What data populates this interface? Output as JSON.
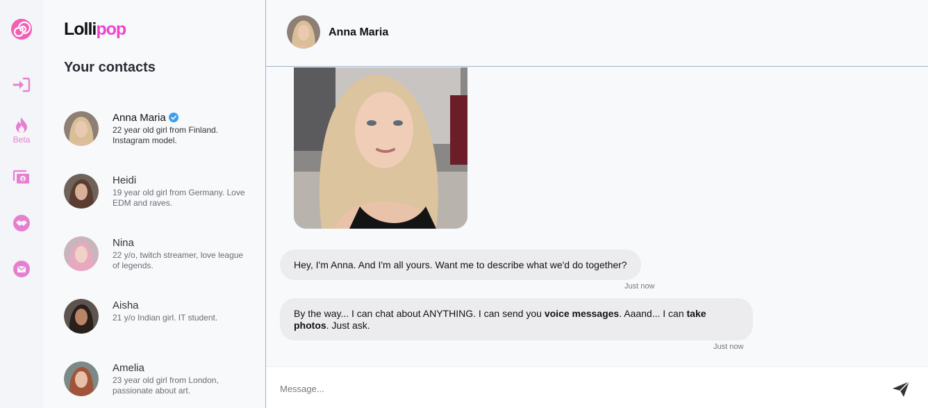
{
  "app": {
    "brand_part1": "Lolli",
    "brand_part2": "pop"
  },
  "rail": {
    "beta_label": "Beta"
  },
  "contacts": {
    "title": "Your contacts",
    "items": [
      {
        "name": "Anna Maria",
        "desc": "22 year old girl from Finland. Instagram model.",
        "verified": true
      },
      {
        "name": "Heidi",
        "desc": "19 year old girl from Germany. Love EDM and raves."
      },
      {
        "name": "Nina",
        "desc": "22 y/o, twitch streamer, love league of legends."
      },
      {
        "name": "Aisha",
        "desc": "21 y/o Indian girl. IT student."
      },
      {
        "name": "Amelia",
        "desc": "23 year old girl from London, passionate about art."
      }
    ]
  },
  "chat": {
    "name": "Anna Maria",
    "messages": [
      {
        "text": "Hey, I'm Anna. And I'm all yours. Want me to describe what we'd do together?",
        "time": "Just now"
      },
      {
        "parts": [
          "By the way... I can chat about ANYTHING. I can send you ",
          "voice messages",
          ". Aaand... I can ",
          "take photos",
          ". Just ask."
        ],
        "time": "Just now"
      }
    ],
    "composer_placeholder": "Message..."
  },
  "colors": {
    "accent": "#ee44cf",
    "rail_icon": "#e67fd0",
    "verified": "#3b9ff0",
    "divider": "#9fb0cc"
  }
}
